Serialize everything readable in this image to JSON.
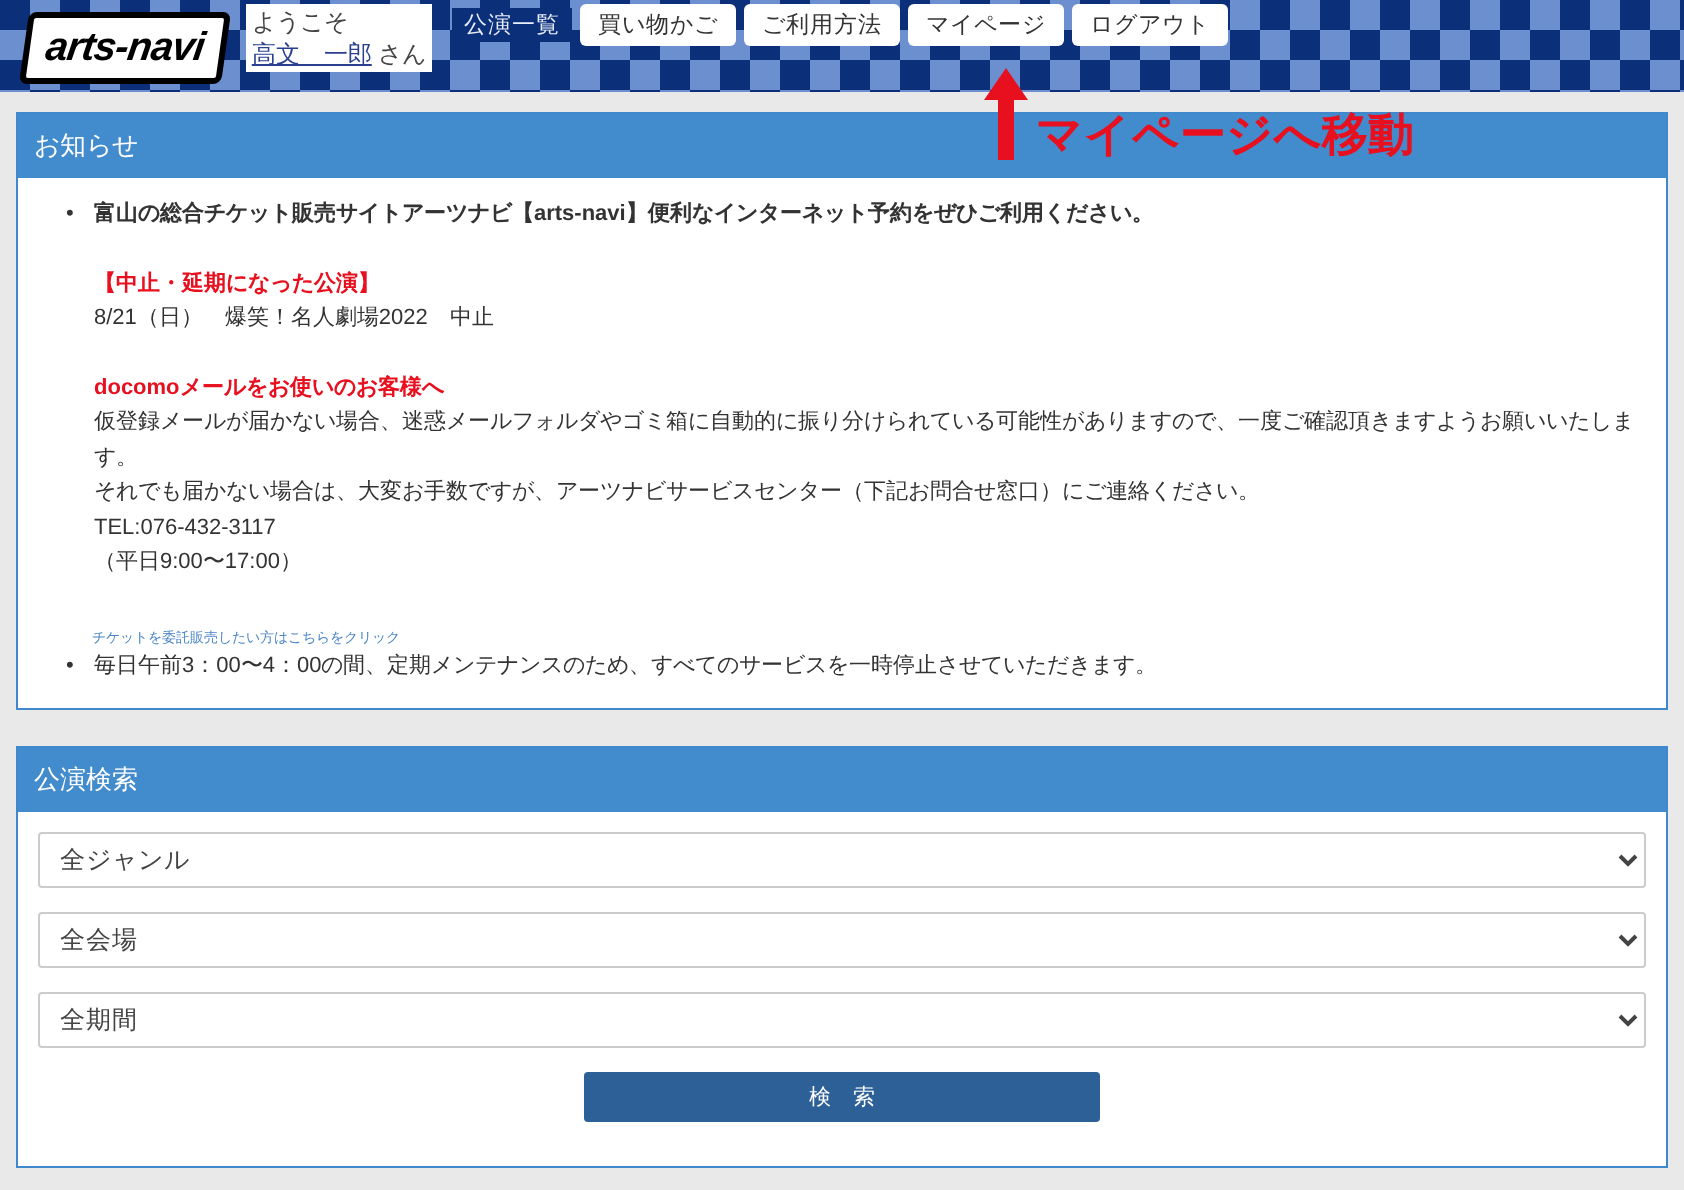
{
  "header": {
    "logo": "arts-navi",
    "welcome": {
      "greeting": "ようこそ",
      "user_name": "高文　一郎",
      "suffix": "さん"
    },
    "nav": [
      {
        "label": "公演一覧",
        "kind": "text"
      },
      {
        "label": "買い物かご",
        "kind": "button"
      },
      {
        "label": "ご利用方法",
        "kind": "button"
      },
      {
        "label": "マイページ",
        "kind": "button"
      },
      {
        "label": "ログアウト",
        "kind": "button"
      }
    ]
  },
  "annotation": {
    "text": "マイページへ移動"
  },
  "notice_panel": {
    "title": "お知らせ",
    "items": [
      {
        "marker": "•",
        "headline": "富山の総合チケット販売サイトアーツナビ【arts-navi】便利なインターネット予約をぜひご利用ください。",
        "emphasis": true,
        "sections": [
          {
            "heading": "【中止・延期になった公演】",
            "lines": [
              "8/21（日）　爆笑！名人劇場2022　中止"
            ]
          },
          {
            "heading": "docomoメールをお使いのお客様へ",
            "lines": [
              "仮登録メールが届かない場合、迷惑メールフォルダやゴミ箱に自動的に振り分けられている可能性がありますので、一度ご確認頂きますようお願いいたします。",
              "それでも届かない場合は、大変お手数ですが、アーツナビサービスセンター（下記お問合せ窓口）にご連絡ください。",
              "TEL:076-432-3117",
              "（平日9:00〜17:00）"
            ]
          }
        ],
        "link": "チケットを委託販売したい方はこちらをクリック"
      },
      {
        "marker": "•",
        "headline": "毎日午前3：00〜4：00の間、定期メンテナンスのため、すべてのサービスを一時停止させていただきます。",
        "emphasis": false
      }
    ]
  },
  "search_panel": {
    "title": "公演検索",
    "selects": [
      "全ジャンル",
      "全会場",
      "全期間"
    ],
    "button": "検　索"
  }
}
